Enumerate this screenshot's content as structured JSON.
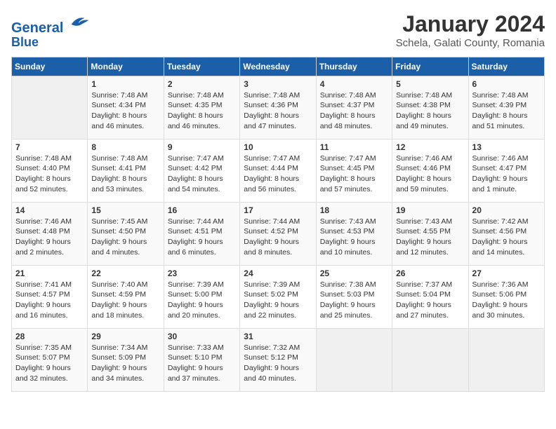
{
  "header": {
    "logo_line1": "General",
    "logo_line2": "Blue",
    "month": "January 2024",
    "location": "Schela, Galati County, Romania"
  },
  "weekdays": [
    "Sunday",
    "Monday",
    "Tuesday",
    "Wednesday",
    "Thursday",
    "Friday",
    "Saturday"
  ],
  "weeks": [
    [
      {
        "day": "",
        "info": ""
      },
      {
        "day": "1",
        "info": "Sunrise: 7:48 AM\nSunset: 4:34 PM\nDaylight: 8 hours and 46 minutes."
      },
      {
        "day": "2",
        "info": "Sunrise: 7:48 AM\nSunset: 4:35 PM\nDaylight: 8 hours and 46 minutes."
      },
      {
        "day": "3",
        "info": "Sunrise: 7:48 AM\nSunset: 4:36 PM\nDaylight: 8 hours and 47 minutes."
      },
      {
        "day": "4",
        "info": "Sunrise: 7:48 AM\nSunset: 4:37 PM\nDaylight: 8 hours and 48 minutes."
      },
      {
        "day": "5",
        "info": "Sunrise: 7:48 AM\nSunset: 4:38 PM\nDaylight: 8 hours and 49 minutes."
      },
      {
        "day": "6",
        "info": "Sunrise: 7:48 AM\nSunset: 4:39 PM\nDaylight: 8 hours and 51 minutes."
      }
    ],
    [
      {
        "day": "7",
        "info": "Sunrise: 7:48 AM\nSunset: 4:40 PM\nDaylight: 8 hours and 52 minutes."
      },
      {
        "day": "8",
        "info": "Sunrise: 7:48 AM\nSunset: 4:41 PM\nDaylight: 8 hours and 53 minutes."
      },
      {
        "day": "9",
        "info": "Sunrise: 7:47 AM\nSunset: 4:42 PM\nDaylight: 8 hours and 54 minutes."
      },
      {
        "day": "10",
        "info": "Sunrise: 7:47 AM\nSunset: 4:44 PM\nDaylight: 8 hours and 56 minutes."
      },
      {
        "day": "11",
        "info": "Sunrise: 7:47 AM\nSunset: 4:45 PM\nDaylight: 8 hours and 57 minutes."
      },
      {
        "day": "12",
        "info": "Sunrise: 7:46 AM\nSunset: 4:46 PM\nDaylight: 8 hours and 59 minutes."
      },
      {
        "day": "13",
        "info": "Sunrise: 7:46 AM\nSunset: 4:47 PM\nDaylight: 9 hours and 1 minute."
      }
    ],
    [
      {
        "day": "14",
        "info": "Sunrise: 7:46 AM\nSunset: 4:48 PM\nDaylight: 9 hours and 2 minutes."
      },
      {
        "day": "15",
        "info": "Sunrise: 7:45 AM\nSunset: 4:50 PM\nDaylight: 9 hours and 4 minutes."
      },
      {
        "day": "16",
        "info": "Sunrise: 7:44 AM\nSunset: 4:51 PM\nDaylight: 9 hours and 6 minutes."
      },
      {
        "day": "17",
        "info": "Sunrise: 7:44 AM\nSunset: 4:52 PM\nDaylight: 9 hours and 8 minutes."
      },
      {
        "day": "18",
        "info": "Sunrise: 7:43 AM\nSunset: 4:53 PM\nDaylight: 9 hours and 10 minutes."
      },
      {
        "day": "19",
        "info": "Sunrise: 7:43 AM\nSunset: 4:55 PM\nDaylight: 9 hours and 12 minutes."
      },
      {
        "day": "20",
        "info": "Sunrise: 7:42 AM\nSunset: 4:56 PM\nDaylight: 9 hours and 14 minutes."
      }
    ],
    [
      {
        "day": "21",
        "info": "Sunrise: 7:41 AM\nSunset: 4:57 PM\nDaylight: 9 hours and 16 minutes."
      },
      {
        "day": "22",
        "info": "Sunrise: 7:40 AM\nSunset: 4:59 PM\nDaylight: 9 hours and 18 minutes."
      },
      {
        "day": "23",
        "info": "Sunrise: 7:39 AM\nSunset: 5:00 PM\nDaylight: 9 hours and 20 minutes."
      },
      {
        "day": "24",
        "info": "Sunrise: 7:39 AM\nSunset: 5:02 PM\nDaylight: 9 hours and 22 minutes."
      },
      {
        "day": "25",
        "info": "Sunrise: 7:38 AM\nSunset: 5:03 PM\nDaylight: 9 hours and 25 minutes."
      },
      {
        "day": "26",
        "info": "Sunrise: 7:37 AM\nSunset: 5:04 PM\nDaylight: 9 hours and 27 minutes."
      },
      {
        "day": "27",
        "info": "Sunrise: 7:36 AM\nSunset: 5:06 PM\nDaylight: 9 hours and 30 minutes."
      }
    ],
    [
      {
        "day": "28",
        "info": "Sunrise: 7:35 AM\nSunset: 5:07 PM\nDaylight: 9 hours and 32 minutes."
      },
      {
        "day": "29",
        "info": "Sunrise: 7:34 AM\nSunset: 5:09 PM\nDaylight: 9 hours and 34 minutes."
      },
      {
        "day": "30",
        "info": "Sunrise: 7:33 AM\nSunset: 5:10 PM\nDaylight: 9 hours and 37 minutes."
      },
      {
        "day": "31",
        "info": "Sunrise: 7:32 AM\nSunset: 5:12 PM\nDaylight: 9 hours and 40 minutes."
      },
      {
        "day": "",
        "info": ""
      },
      {
        "day": "",
        "info": ""
      },
      {
        "day": "",
        "info": ""
      }
    ]
  ]
}
